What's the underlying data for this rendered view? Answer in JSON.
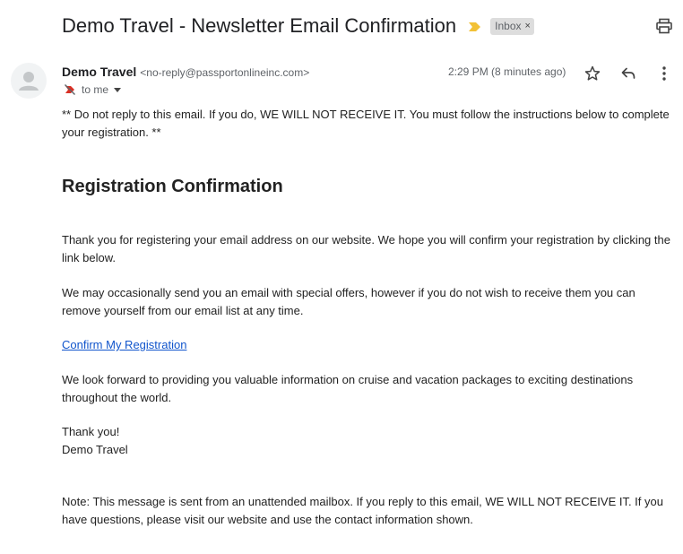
{
  "subject": {
    "title": "Demo Travel - Newsletter Email Confirmation",
    "label": "Inbox",
    "label_close": "×",
    "importance_color": "#f2c136"
  },
  "header_actions": {
    "print_icon": "printer-icon"
  },
  "sender": {
    "name": "Demo Travel",
    "email": "<no-reply@passportonlineinc.com>",
    "to": "to me",
    "timestamp": "2:29 PM (8 minutes ago)",
    "avatar_icon": "person-icon"
  },
  "message_actions": {
    "star_icon": "star-icon",
    "reply_icon": "reply-icon",
    "more_icon": "more-vertical-icon"
  },
  "body": {
    "warning": "** Do not reply to this email. If you do, WE WILL NOT RECEIVE IT. You must follow the instructions below to complete your registration. **",
    "heading": "Registration Confirmation",
    "thanks": "Thank you for registering your email address on our website. We hope you will confirm your registration by clicking the link below.",
    "offers": "We may occasionally send you an email with special offers, however if you do not wish to receive them you can remove yourself from our email list at any time.",
    "confirm_link": "Confirm My Registration",
    "look_forward": "We look forward to providing you valuable information on cruise and vacation packages to exciting destinations throughout the world.",
    "thank_you": "Thank you!",
    "signature": "Demo Travel",
    "note": "Note: This message is sent from an unattended mailbox. If you reply to this email, WE WILL NOT RECEIVE IT. If you have questions, please visit our website and use the contact information shown."
  },
  "colors": {
    "link": "#1155cc",
    "chip_bg": "#dddddd",
    "secondary_text": "#5f6368"
  }
}
